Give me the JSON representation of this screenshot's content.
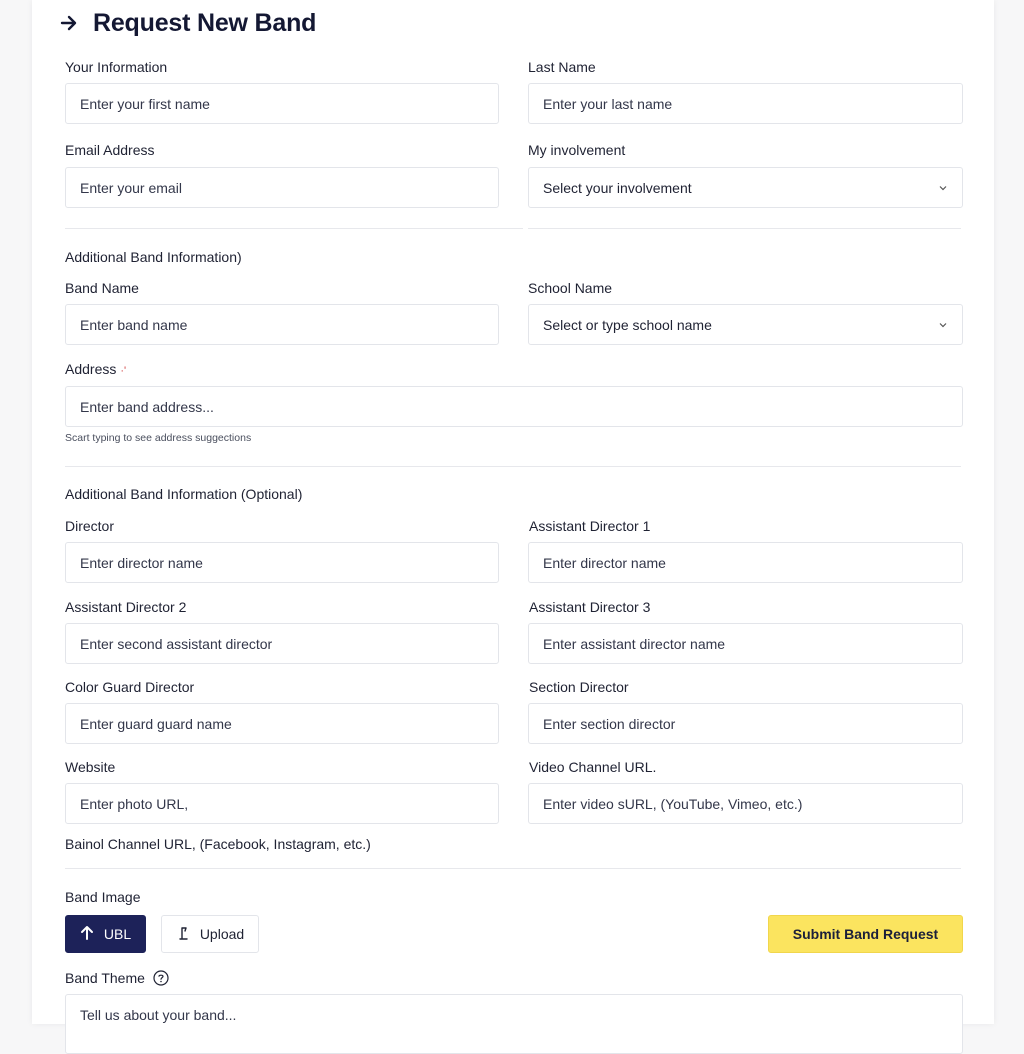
{
  "header": {
    "title": "Request New Band",
    "icon": "arrow-right-icon"
  },
  "your_info": {
    "first_name": {
      "label": "Your Information",
      "placeholder": "Enter your first name"
    },
    "last_name": {
      "label": "Last Name",
      "placeholder": "Enter your last name"
    },
    "email": {
      "label": "Email Address",
      "placeholder": "Enter your email"
    },
    "involvement": {
      "label": "My involvement",
      "value": "Select your involvement"
    }
  },
  "band_info": {
    "section_title": "Additional Band Information)",
    "band_name": {
      "label": "Band Name",
      "placeholder": "Enter band name"
    },
    "school_name": {
      "label": "School Name",
      "value": "Select or type school name"
    },
    "address": {
      "label": "Address",
      "required_mark": "·'",
      "placeholder": "Enter band address...",
      "helper": "Scart typing to see address suggections"
    }
  },
  "optional_info": {
    "section_title": "Additional Band Information (Optional)",
    "director": {
      "label": "Director",
      "placeholder": "Enter director name"
    },
    "assistant_director_1": {
      "label": "Assistant Director 1",
      "placeholder": "Enter director name"
    },
    "assistant_director_2": {
      "label": "Assistant Director 2",
      "placeholder": "Enter second assistant director"
    },
    "assistant_director_3": {
      "label": "Assistant Director 3",
      "placeholder": "Enter assistant director name"
    },
    "color_guard_director": {
      "label": "Color Guard Director",
      "placeholder": "Enter guard guard name"
    },
    "section_director": {
      "label": "Section Director",
      "placeholder": "Enter section director"
    },
    "website": {
      "label": "Website",
      "placeholder": "Enter photo URL,"
    },
    "video_channel": {
      "label": "Video Channel URL.",
      "placeholder": "Enter video sURL, (YouTube, Vimeo, etc.)"
    },
    "social_channel_label": "Bainol Channel URL, (Facebook, Instagram, etc.)"
  },
  "band_image": {
    "label": "Band Image",
    "url_button": "UBL",
    "upload_button": "Upload",
    "submit_button": "Submit Band Request"
  },
  "band_theme": {
    "label": "Band Theme",
    "placeholder": "Tell us about your band..."
  },
  "colors": {
    "primary": "#1d2259",
    "accent": "#fbe45f",
    "border": "#e3e5ea"
  }
}
